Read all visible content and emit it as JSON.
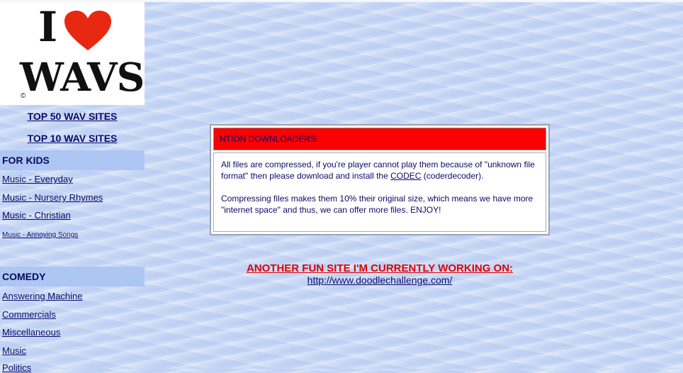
{
  "logo": {
    "letter": "I",
    "word": "WAVS",
    "copyright": "©",
    "heart_color": "#e82810"
  },
  "top_links": [
    {
      "label": "TOP 50 WAV SITES"
    },
    {
      "label": "TOP 10 WAV SITES"
    }
  ],
  "sections": {
    "kids": {
      "title": "FOR KIDS",
      "items": [
        {
          "label": "Music - Everyday"
        },
        {
          "label": "Music - Nursery Rhymes"
        },
        {
          "label": "Music - Christian"
        },
        {
          "label": "Music - Annoying Songs"
        }
      ]
    },
    "comedy": {
      "title": "COMEDY",
      "items": [
        {
          "label": "Answering Machine"
        },
        {
          "label": "Commercials"
        },
        {
          "label": "Miscellaneous"
        },
        {
          "label": "Music"
        },
        {
          "label": "Politics"
        }
      ]
    }
  },
  "notice": {
    "header": "NTION DOWNLOADERS:",
    "para1_before": "All files are compressed, if you're player cannot play them because of \"unknown file format\" then please download and install the ",
    "codec_link": "CODEC",
    "para1_after": " (coderdecoder).",
    "para2": "Compressing files makes them 10% their original size, which means we have more \"internet space\" and thus, we can offer more files. ENJOY!"
  },
  "fun_site": {
    "heading": "ANOTHER FUN SITE I'M CURRENTLY WORKING ON:",
    "url": "http://www.doodlechallenge.com/"
  },
  "colors": {
    "link": "#0a0a6a",
    "section_bg": "#aec6f4",
    "alert_red": "#ff0000"
  }
}
